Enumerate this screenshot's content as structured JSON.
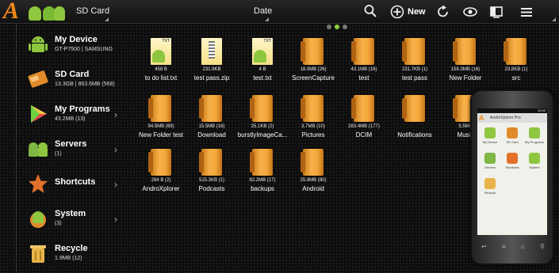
{
  "topbar": {
    "title": "SD Card",
    "sort_label": "Date",
    "new_label": "New",
    "icons": [
      "search-icon",
      "add-icon",
      "refresh-icon",
      "view-icon",
      "panel-icon",
      "menu-icon"
    ]
  },
  "colors": {
    "accent": "#f2891b",
    "android_green": "#8ec63f",
    "folder": "#f4a83c",
    "page_dot_active": "#8fd13f"
  },
  "sidebar": {
    "items": [
      {
        "label": "My Device",
        "sub": "GT-P7500 | SAMSUNG",
        "icon": "android-icon",
        "chevron": false
      },
      {
        "label": "SD Card",
        "sub": "13.3GB | 863.6MB (568)",
        "icon": "sd-card-icon",
        "chevron": false
      },
      {
        "label": "My Programs",
        "sub": "43.2MB (13)",
        "icon": "play-store-icon",
        "chevron": true
      },
      {
        "label": "Servers",
        "sub": "(1)",
        "icon": "servers-icon",
        "chevron": true
      },
      {
        "label": "Shortcuts",
        "sub": "",
        "icon": "star-icon",
        "chevron": true
      },
      {
        "label": "System",
        "sub": "(3)",
        "icon": "system-icon",
        "chevron": true
      },
      {
        "label": "Recycle",
        "sub": "1.9MB (12)",
        "icon": "trash-icon",
        "chevron": false
      }
    ]
  },
  "files": [
    {
      "name": "to do list.txt",
      "meta": "458 B",
      "type": "txt"
    },
    {
      "name": "test pass.zip",
      "meta": "231.9KB",
      "type": "zip"
    },
    {
      "name": "test.txt",
      "meta": "4 B",
      "type": "txt"
    },
    {
      "name": "ScreenCapture",
      "meta": "18.0MB (26)",
      "type": "folder"
    },
    {
      "name": "test",
      "meta": "43.1MB (16)",
      "type": "folder"
    },
    {
      "name": "test pass",
      "meta": "231.7KB (1)",
      "type": "folder"
    },
    {
      "name": "New Folder",
      "meta": "158.3MB (16)",
      "type": "folder"
    },
    {
      "name": "src",
      "meta": "23.8KB (1)",
      "type": "folder"
    },
    {
      "name": "New Folder test",
      "meta": "94.5MB (69)",
      "type": "folder"
    },
    {
      "name": "Download",
      "meta": "15.5MB (16)",
      "type": "folder"
    },
    {
      "name": "burstlyImageCa...",
      "meta": "25.1KB (2)",
      "type": "folder"
    },
    {
      "name": "Pictures",
      "meta": "3.7MB (10)",
      "type": "folder"
    },
    {
      "name": "DCIM",
      "meta": "283.4MB (177)",
      "type": "folder"
    },
    {
      "name": "Notifications",
      "meta": "",
      "type": "folder"
    },
    {
      "name": "Music",
      "meta": "5.5MB",
      "type": "folder"
    },
    {
      "name": "",
      "meta": "",
      "type": "folder"
    },
    {
      "name": "AndroXplorer",
      "meta": "284 B (2)",
      "type": "folder"
    },
    {
      "name": "Podcasts",
      "meta": "515.3KB (1)",
      "type": "folder"
    },
    {
      "name": "backups",
      "meta": "82.2MB (17)",
      "type": "folder"
    },
    {
      "name": "Android",
      "meta": "25.8MB (80)",
      "type": "folder"
    }
  ],
  "phone": {
    "title": "AndroXplorer Pro",
    "status_time": "10:42",
    "items": [
      {
        "label": "My Device",
        "color": "#8ec63f"
      },
      {
        "label": "SD Card",
        "color": "#e08a2a"
      },
      {
        "label": "My Programs",
        "color": "#8ec63f"
      },
      {
        "label": "Servers",
        "color": "#7fb845"
      },
      {
        "label": "Shortcuts",
        "color": "#e0702a"
      },
      {
        "label": "System",
        "color": "#8ec63f"
      },
      {
        "label": "Recycle",
        "color": "#e8b34a"
      }
    ]
  }
}
